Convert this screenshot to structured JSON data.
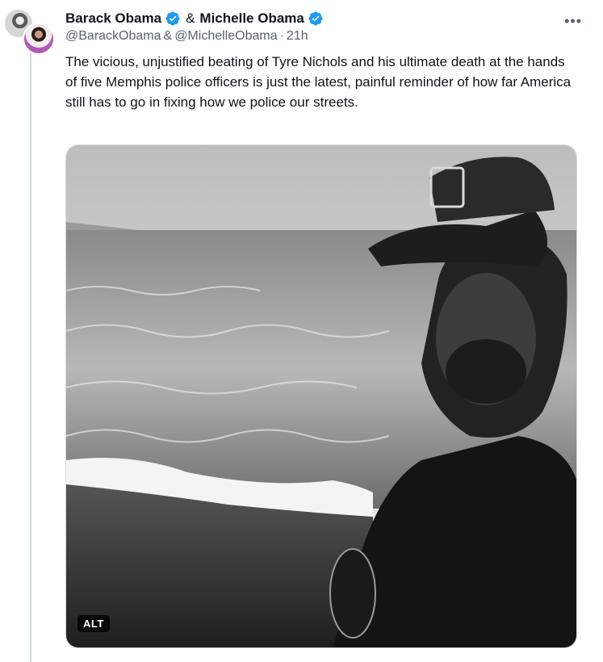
{
  "tweet": {
    "author_primary": "Barack Obama",
    "ampersand": "&",
    "author_secondary": "Michelle Obama",
    "handle_primary": "@BarackObama",
    "handle_secondary": "@MichelleObama",
    "separator": "·",
    "timestamp": "21h",
    "text": "The vicious, unjustified beating of Tyre Nichols and his ultimate death at the hands of five Memphis police officers is just the latest, painful reminder of how far America still has to go in fixing how we police our streets.",
    "more_icon": "more-horizontal-icon",
    "verified_color": "#1d9bf0",
    "media": {
      "alt_label": "ALT",
      "cap_logo": "LAC"
    }
  },
  "colors": {
    "text": "#0f1419",
    "secondary": "#536471",
    "border": "#cfd9de"
  }
}
